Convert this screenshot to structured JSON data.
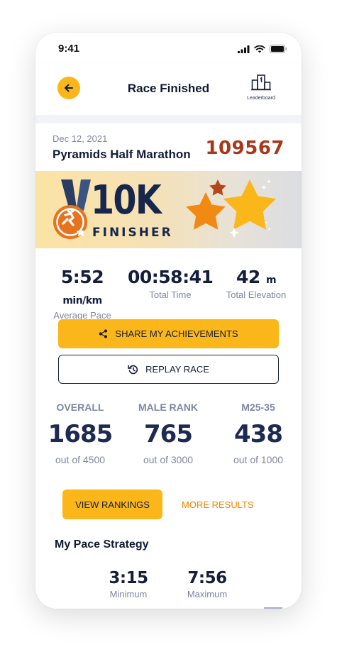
{
  "status_bar": {
    "time": "9:41"
  },
  "header": {
    "title": "Race Finished",
    "leaderboard_label": "Leaderboard"
  },
  "race": {
    "date": "Dec 12, 2021",
    "name": "Pyramids Half Marathon",
    "bib_number": "109567"
  },
  "banner": {
    "distance": "10K",
    "subtitle": "FINISHER"
  },
  "stats": [
    {
      "value": "5:52",
      "unit": "min/km",
      "caption": "Average Pace"
    },
    {
      "value": "00:58:41",
      "unit": "",
      "caption": "Total Time"
    },
    {
      "value": "42",
      "unit": "m",
      "caption": "Total Elevation"
    }
  ],
  "actions": {
    "share_label": "SHARE MY ACHIEVEMENTS",
    "replay_label": "REPLAY RACE"
  },
  "rankings": [
    {
      "heading": "OVERALL",
      "rank": "1685",
      "out_of": "out of 4500"
    },
    {
      "heading": "MALE RANK",
      "rank": "765",
      "out_of": "out of 3000"
    },
    {
      "heading": "M25-35",
      "rank": "438",
      "out_of": "out of 1000"
    }
  ],
  "ranking_actions": {
    "view_label": "VIEW RANKINGS",
    "more_label": "MORE RESULTS"
  },
  "pace_strategy": {
    "title": "My Pace Strategy",
    "items": [
      {
        "value": "3:15",
        "caption": "Minimum"
      },
      {
        "value": "7:56",
        "caption": "Maximum"
      }
    ]
  },
  "colors": {
    "accent": "#fbb619",
    "bib": "#a8381a",
    "link": "#f08400",
    "text": "#141d3a",
    "muted": "#7f86a2",
    "medal": "#e8731e"
  },
  "icons": [
    "back-arrow-icon",
    "leaderboard-icon",
    "share-icon",
    "replay-icon",
    "signal-icon",
    "wifi-icon",
    "battery-icon",
    "medal-icon",
    "star-icon"
  ]
}
